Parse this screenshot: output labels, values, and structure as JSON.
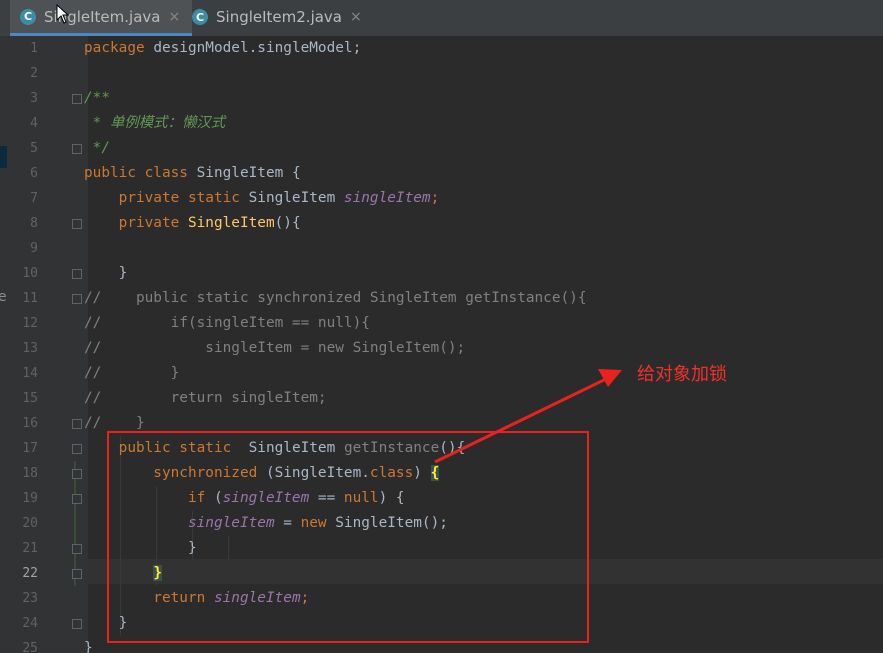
{
  "tabs": [
    {
      "icon": "C",
      "label": "SingleItem.java",
      "active": true
    },
    {
      "icon": "C",
      "label": "SingleItem2.java",
      "active": false
    }
  ],
  "close_glyph": "×",
  "edge_letter": "e",
  "line_numbers": [
    "1",
    "2",
    "3",
    "4",
    "5",
    "6",
    "7",
    "8",
    "9",
    "10",
    "11",
    "12",
    "13",
    "14",
    "15",
    "16",
    "17",
    "18",
    "19",
    "20",
    "21",
    "22",
    "23",
    "24",
    "25"
  ],
  "current_line": "22",
  "code": {
    "l1": {
      "kw": "package",
      "rest": " designModel.singleModel;"
    },
    "l3": "/**",
    "l4": " * 单例模式：懒汉式",
    "l5": " */",
    "l6": {
      "kw": "public class",
      "cls": " SingleItem",
      "rest": " {"
    },
    "l7": {
      "kw": "    private static",
      "type": " SingleItem ",
      "field": "singleItem",
      "semi": ";"
    },
    "l8": {
      "kw": "    private",
      "fn": " SingleItem",
      "rest": "(){"
    },
    "l10": "    }",
    "l11": "//    public static synchronized SingleItem getInstance(){",
    "l12": "//        if(singleItem == null){",
    "l13": "//            singleItem = new SingleItem();",
    "l14": "//        }",
    "l15": "//        return singleItem;",
    "l16": "//    }",
    "l17": {
      "kw": "    public static",
      "type": "  SingleItem ",
      "method": "getInstance",
      "rest": "(){"
    },
    "l18": {
      "kw": "        synchronized",
      "open": " (SingleItem.",
      "kw2": "class",
      "close": ") ",
      "brace": "{"
    },
    "l19": {
      "kw": "            if",
      "open": " (",
      "field": "singleItem",
      "mid": " == ",
      "kw2": "null",
      "rest": ") {"
    },
    "l20": {
      "indent": "            ",
      "field": "singleItem",
      "mid": " = ",
      "kw": "new",
      "rest": " SingleItem();"
    },
    "l21": "            }",
    "l22": {
      "indent": "        ",
      "brace": "}"
    },
    "l23": {
      "kw": "        return",
      "sp": " ",
      "field": "singleItem",
      "semi": ";"
    },
    "l24": "    }",
    "l25": "}"
  },
  "annotation": {
    "label": "给对象加锁",
    "color": "#e8231f"
  },
  "colors": {
    "background": "#2b2b2b",
    "keyword": "#cc7832",
    "comment": "#808080",
    "doc_comment": "#629755",
    "field": "#9876aa",
    "method": "#ffc66d",
    "text": "#a9b7c6"
  }
}
